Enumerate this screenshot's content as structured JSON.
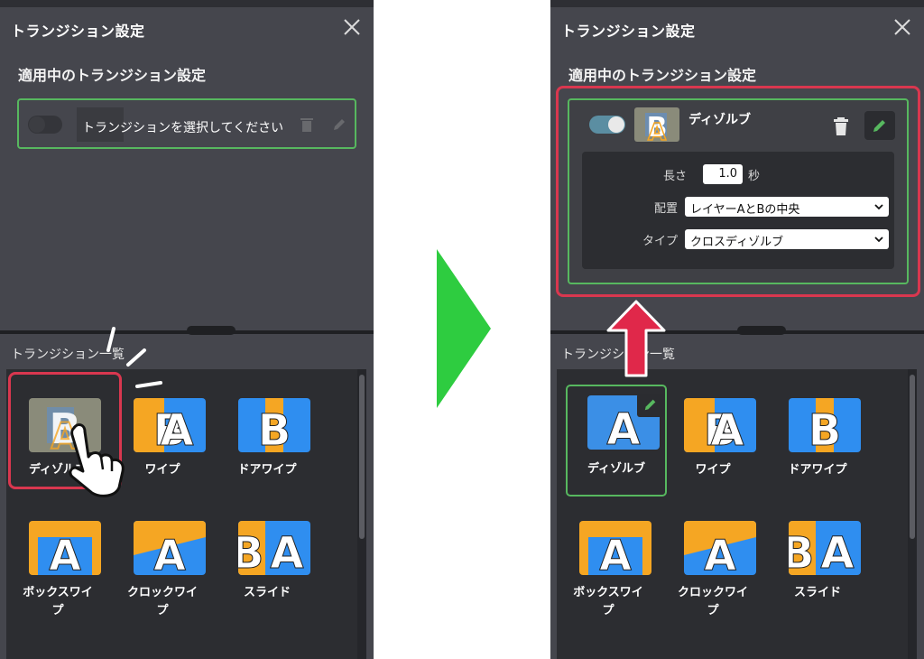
{
  "left_panel": {
    "title": "トランジション設定",
    "section_title": "適用中のトランジション設定",
    "empty_message": "トランジションを選択してください",
    "list_title": "トランジション一覧",
    "items": [
      {
        "label": "ディゾルブ",
        "icon": "dissolve-thumb"
      },
      {
        "label": "ワイプ",
        "icon": "wipe-thumb"
      },
      {
        "label": "ドアワイプ",
        "icon": "door-wipe-thumb"
      },
      {
        "label": "ボックスワイプ",
        "icon": "box-wipe-thumb"
      },
      {
        "label": "クロックワイプ",
        "icon": "clock-wipe-thumb"
      },
      {
        "label": "スライド",
        "icon": "slide-thumb"
      }
    ]
  },
  "right_panel": {
    "title": "トランジション設定",
    "section_title": "適用中のトランジション設定",
    "active": {
      "name": "ディゾルブ",
      "enabled": true,
      "length_label": "長さ",
      "length_value": "1.0",
      "length_unit": "秒",
      "placement_label": "配置",
      "placement_value": "レイヤーAとBの中央",
      "type_label": "タイプ",
      "type_value": "クロスディゾルブ"
    },
    "list_title": "トランジション一覧",
    "items": [
      {
        "label": "ディゾルブ",
        "icon": "dissolve-thumb"
      },
      {
        "label": "ワイプ",
        "icon": "wipe-thumb"
      },
      {
        "label": "ドアワイプ",
        "icon": "door-wipe-thumb"
      },
      {
        "label": "ボックスワイプ",
        "icon": "box-wipe-thumb"
      },
      {
        "label": "クロックワイプ",
        "icon": "clock-wipe-thumb"
      },
      {
        "label": "スライド",
        "icon": "slide-thumb"
      }
    ]
  },
  "colors": {
    "panel_bg": "#45464d",
    "list_bg": "#2c2d31",
    "accent_green": "#57b85f",
    "highlight_red": "#d9374f",
    "arrow_green": "#2ecc40",
    "thumb_blue": "#2f8ef0",
    "thumb_orange": "#f5a623"
  }
}
